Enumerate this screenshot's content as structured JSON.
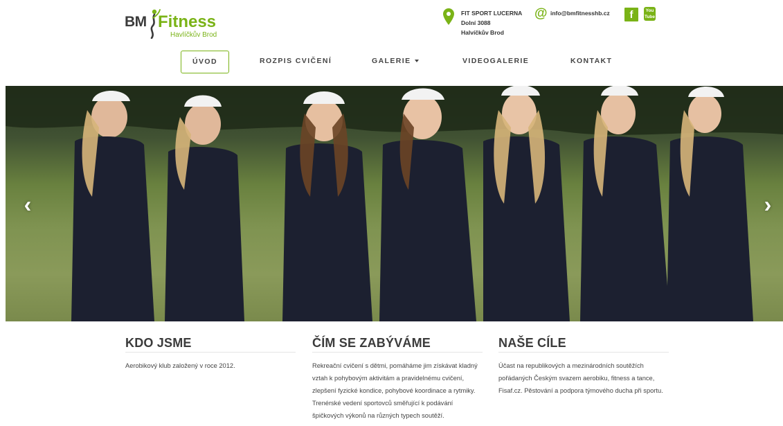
{
  "header": {
    "logo": {
      "brand": "BM",
      "name": "Fitness",
      "city": "Havlíčkův Brod"
    },
    "address": {
      "line1": "FIT SPORT LUCERNA",
      "line2": "Dolní 3088",
      "line3": "Halvíčkův Brod"
    },
    "email": "info@bmfitnesshb.cz",
    "facebook_glyph": "f",
    "youtube": {
      "line1": "You",
      "line2": "Tube"
    },
    "icons": [
      "map-pin-icon",
      "at-icon",
      "facebook-icon",
      "youtube-icon"
    ]
  },
  "nav": {
    "items": [
      {
        "label": "ÚVOD",
        "active": true
      },
      {
        "label": "ROZPIS CVIČENÍ"
      },
      {
        "label": "GALERIE"
      },
      {
        "label": "VIDEOGALERIE"
      },
      {
        "label": "KONTAKT"
      }
    ]
  },
  "carousel": {
    "prev": "‹",
    "next": "›"
  },
  "columns": [
    {
      "title": "KDO JSME",
      "text": "Aerobikový klub založený v roce 2012."
    },
    {
      "title": "ČÍM SE ZABÝVÁME",
      "text": "Rekreační cvičení s dětmi, pomáháme jim získávat kladný vztah k pohybovým aktivitám a pravidelnému cvičení, zlepšení fyzické kondice, pohybové koordinace a rytmiky. Trenérské vedení sportovců směřující k podávání špičkových výkonů na různých typech soutěží."
    },
    {
      "title": "NAŠE CÍLE",
      "text": "Účast na republikových a mezinárodních soutěžích pořádaných Českým svazem aerobiku, fitness a tance, Fisaf.cz. Pěstování a podpora týmového ducha při sportu."
    }
  ],
  "colors": {
    "accent": "#7ab317",
    "text": "#333333"
  }
}
